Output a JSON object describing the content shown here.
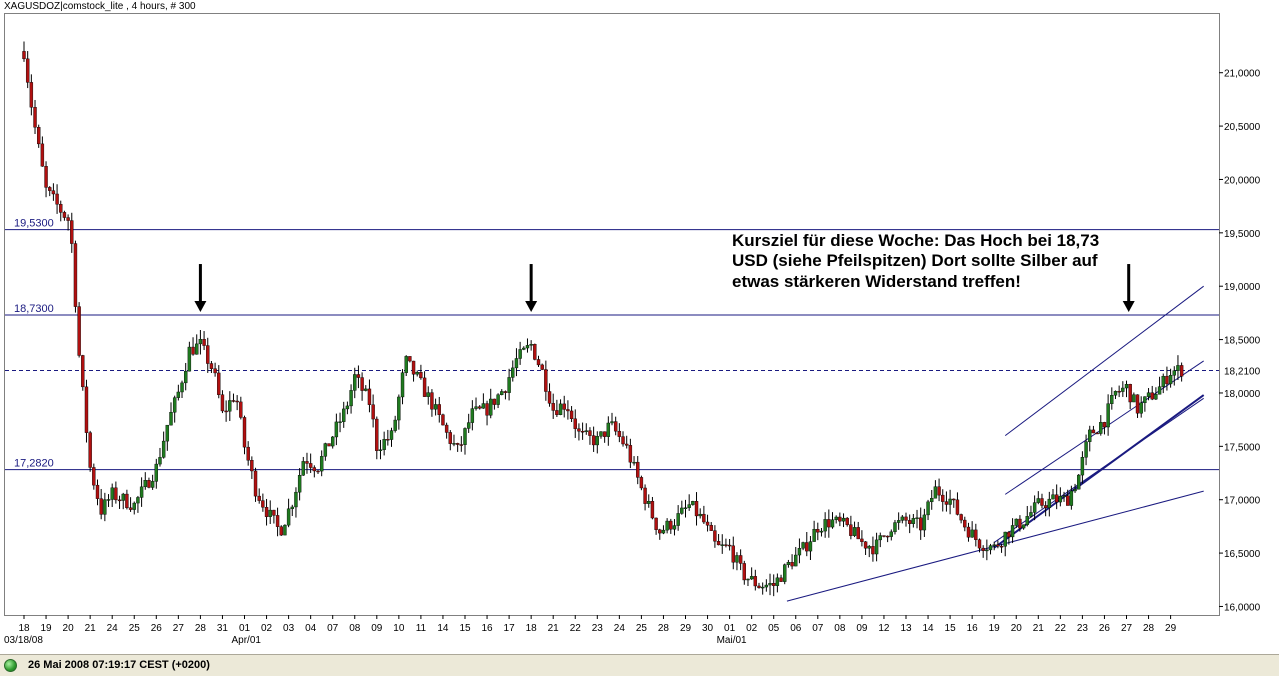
{
  "header": {
    "title": "XAGUSDOZ|comstock_lite , 4 hours, # 300"
  },
  "status": {
    "text": "26 Mai 2008 07:19:17  CEST (+0200)"
  },
  "annotation": {
    "lines": [
      "Kursziel für diese Woche: Das Hoch bei 18,73",
      "USD (siehe Pfeilspitzen) Dort sollte Silber auf",
      "etwas stärkeren Widerstand treffen!"
    ]
  },
  "colors": {
    "up": "#1f7a1f",
    "down": "#b01010",
    "level": "#1a1a80",
    "trend": "#1a1a80"
  },
  "chart_data": {
    "type": "candlestick",
    "y_ticks": [
      "16,0000",
      "16,5000",
      "17,0000",
      "17,5000",
      "18,0000",
      "18,5000",
      "19,0000",
      "19,5000",
      "20,0000",
      "20,5000",
      "21,0000"
    ],
    "y_tick_values": [
      16.0,
      16.5,
      17.0,
      17.5,
      18.0,
      18.5,
      19.0,
      19.5,
      20.0,
      20.5,
      21.0
    ],
    "ylim": [
      15.92,
      21.55
    ],
    "x_day_labels": [
      "18",
      "19",
      "20",
      "21",
      "24",
      "25",
      "26",
      "27",
      "28",
      "31",
      "01",
      "02",
      "03",
      "04",
      "07",
      "08",
      "09",
      "10",
      "11",
      "14",
      "15",
      "16",
      "17",
      "18",
      "21",
      "22",
      "23",
      "24",
      "25",
      "28",
      "29",
      "30",
      "01",
      "02",
      "05",
      "06",
      "07",
      "08",
      "09",
      "12",
      "13",
      "14",
      "15",
      "16",
      "19",
      "20",
      "21",
      "22",
      "23",
      "26",
      "27",
      "28",
      "29"
    ],
    "x_month_labels": [
      {
        "label": "03/18/08",
        "at_index": 0
      },
      {
        "label": "Apr/01",
        "at_index": 10
      },
      {
        "label": "Mai/01",
        "at_index": 32
      }
    ],
    "levels": [
      {
        "label": "19,5300",
        "value": 19.53,
        "style": "solid"
      },
      {
        "label": "18,7300",
        "value": 18.73,
        "style": "solid"
      },
      {
        "label": "17,2820",
        "value": 17.282,
        "style": "solid"
      },
      {
        "label": "18,2100",
        "value": 18.21,
        "style": "dashed"
      }
    ],
    "arrow_day_indices": [
      8,
      23,
      50.1
    ],
    "trendlines": [
      {
        "from": [
          34.6,
          16.05
        ],
        "to": [
          53.5,
          17.08
        ]
      },
      {
        "from": [
          44.0,
          16.6
        ],
        "to": [
          53.5,
          17.95
        ]
      },
      {
        "from": [
          44.0,
          16.55
        ],
        "to": [
          53.5,
          17.98
        ]
      },
      {
        "from": [
          44.5,
          17.05
        ],
        "to": [
          53.5,
          18.3
        ]
      },
      {
        "from": [
          44.5,
          17.6
        ],
        "to": [
          53.5,
          19.0
        ]
      }
    ],
    "close_path": [
      [
        0,
        21.2
      ],
      [
        0.4,
        20.6
      ],
      [
        1,
        19.9
      ],
      [
        1.7,
        19.7
      ],
      [
        2.1,
        19.6
      ],
      [
        2.5,
        18.35
      ],
      [
        3,
        17.3
      ],
      [
        3.5,
        16.9
      ],
      [
        4,
        17.05
      ],
      [
        5,
        16.95
      ],
      [
        6,
        17.3
      ],
      [
        6.5,
        17.7
      ],
      [
        7,
        18.0
      ],
      [
        7.5,
        18.4
      ],
      [
        8,
        18.45
      ],
      [
        8.6,
        18.2
      ],
      [
        9,
        17.8
      ],
      [
        9.6,
        18.0
      ],
      [
        10,
        17.5
      ],
      [
        10.5,
        17.1
      ],
      [
        11,
        16.9
      ],
      [
        11.6,
        16.7
      ],
      [
        12.2,
        17.0
      ],
      [
        12.7,
        17.4
      ],
      [
        13.3,
        17.3
      ],
      [
        14,
        17.6
      ],
      [
        14.6,
        17.85
      ],
      [
        15,
        18.15
      ],
      [
        15.7,
        17.9
      ],
      [
        16,
        17.5
      ],
      [
        16.7,
        17.6
      ],
      [
        17.3,
        18.3
      ],
      [
        17.8,
        18.15
      ],
      [
        18.5,
        17.9
      ],
      [
        19.2,
        17.6
      ],
      [
        19.7,
        17.45
      ],
      [
        20.3,
        17.8
      ],
      [
        21,
        17.85
      ],
      [
        21.8,
        18.05
      ],
      [
        22.3,
        18.3
      ],
      [
        23,
        18.45
      ],
      [
        23.5,
        18.2
      ],
      [
        24,
        17.85
      ],
      [
        24.6,
        17.9
      ],
      [
        25.2,
        17.6
      ],
      [
        26,
        17.55
      ],
      [
        26.6,
        17.7
      ],
      [
        27.3,
        17.5
      ],
      [
        28,
        17.1
      ],
      [
        28.8,
        16.7
      ],
      [
        29.5,
        16.8
      ],
      [
        30.2,
        16.95
      ],
      [
        30.8,
        16.8
      ],
      [
        31.4,
        16.55
      ],
      [
        32,
        16.55
      ],
      [
        32.6,
        16.3
      ],
      [
        33.3,
        16.2
      ],
      [
        34,
        16.2
      ],
      [
        34.7,
        16.4
      ],
      [
        35.4,
        16.55
      ],
      [
        36,
        16.75
      ],
      [
        36.6,
        16.8
      ],
      [
        37.3,
        16.75
      ],
      [
        38,
        16.6
      ],
      [
        38.6,
        16.55
      ],
      [
        39.3,
        16.75
      ],
      [
        40,
        16.8
      ],
      [
        40.7,
        16.75
      ],
      [
        41.3,
        17.1
      ],
      [
        42,
        17.0
      ],
      [
        42.7,
        16.75
      ],
      [
        43.3,
        16.6
      ],
      [
        44,
        16.55
      ],
      [
        44.6,
        16.7
      ],
      [
        45.3,
        16.8
      ],
      [
        46,
        16.95
      ],
      [
        46.7,
        17.0
      ],
      [
        47.3,
        17.0
      ],
      [
        47.8,
        17.2
      ],
      [
        48.3,
        17.6
      ],
      [
        49,
        17.75
      ],
      [
        49.5,
        18.0
      ],
      [
        50,
        18.05
      ],
      [
        50.5,
        17.85
      ],
      [
        51,
        17.95
      ],
      [
        51.5,
        18.05
      ],
      [
        52,
        18.2
      ],
      [
        52.5,
        18.22
      ]
    ]
  }
}
